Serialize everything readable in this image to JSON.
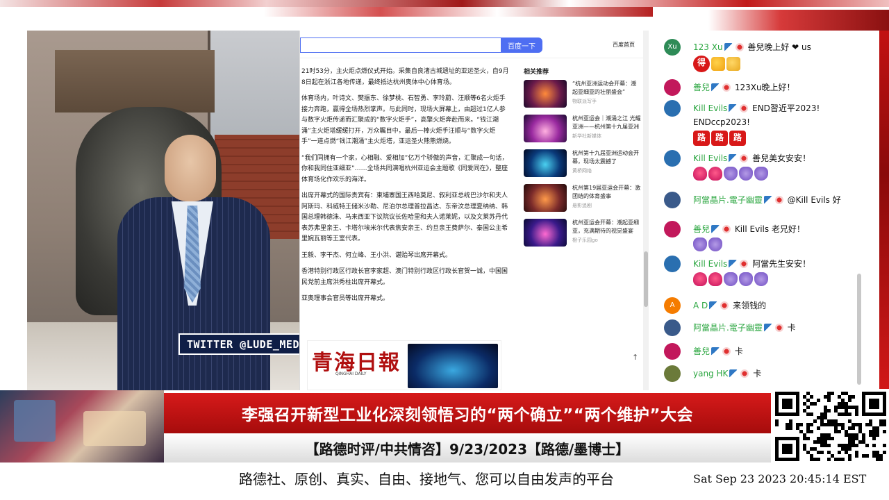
{
  "video": {
    "twitter_label": "TWITTER  @LUDE_MEDIA"
  },
  "browser": {
    "search_button": "百度一下",
    "home_link": "百度首页",
    "article_paragraphs": [
      "21时53分，主火炬点燃仪式开始。采集自良渚古城遗址的亚运圣火，自9月8日起在浙江各地传递，最终抵达杭州奥体中心体育场。",
      "体育场内，叶诗文、樊振东、徐梦桃、石智勇、李玲蔚、汪顺等6名火炬手接力奔跑，赢得全场热烈掌声。与此同时，现场大屏幕上，由超过1亿人参与数字火炬传递而汇聚成的“数字火炬手”，高擎火炬奔赴而来。“钱江潮涌”主火炬塔缓缓打开，万众瞩目中，最后一棒火炬手汪顺与“数字火炬手”一道点燃“钱江潮涌”主火炬塔，亚运圣火熊熊燃烧。",
      "“我们同拥有一个家，心相融、爱相加”亿万个骄傲的声音，汇聚成一句话，你和我同住亚细亚”……全场共同演唱杭州亚运会主题歌《同爱同在》，整座体育场化作欢乐的海洋。",
      "出席开幕式的国际贵宾有：柬埔寨国王西哈莫尼、叙利亚总统巴沙尔和夫人阿斯玛、科威特王储米沙勒、尼泊尔总理普拉昌达、东帝汶总理夏纳纳、韩国总理韩德洙、马来西亚下议院议长佐哈里和夫人诺莱妮，以及文莱苏丹代表苏弗里亲王、卡塔尔埃米尔代表焦安亲王、约旦亲王费萨尔、泰国公主希里婉瓦丽等王室代表。",
      "王毅、李干杰、何立峰、王小洪、谌贻琴出席开幕式。",
      "香港特别行政区行政长官李家超、澳门特别行政区行政长官贺一诚，中国国民党前主席洪秀柱出席开幕式。",
      "亚奥理事会官员等出席开幕式。"
    ],
    "related_title": "相关推荐",
    "related": [
      {
        "title": "“杭州亚洲运动会开幕：潮起亚细亚的壮丽盛会”",
        "source": "物联派写手"
      },
      {
        "title": "杭州亚运会｜潮涌之江 光耀亚洲——杭州第十九届亚洲",
        "source": "新华社新媒体"
      },
      {
        "title": "杭州第十九届亚洲运动会开幕，现场太震撼了",
        "source": "黄桥网络"
      },
      {
        "title": "杭州第19届亚运会开幕：激团结的体育盛事",
        "source": "悬影追剧"
      },
      {
        "title": "杭州亚运会开幕：潮起亚细亚，充满期待的视觉盛宴",
        "source": "橙子乐园go"
      }
    ],
    "newspaper_title": "青海日報",
    "newspaper_sub": "QINGHAI DAILY"
  },
  "chat": {
    "messages": [
      {
        "name": "123 Xu",
        "text": "善兒晚上好 ❤ us",
        "avatar_letter": "Xu",
        "avatar_color": "#2e8b57",
        "emojis": [
          "de",
          "mus",
          "thumb"
        ]
      },
      {
        "name": "善兒",
        "text": "123Xu晚上好！",
        "avatar_letter": "",
        "avatar_color": "#c2185b",
        "emojis": []
      },
      {
        "name": "Kill Evils",
        "text": "END習近平2023! ENDccp2023!",
        "avatar_letter": "",
        "avatar_color": "#2a6fb0",
        "emojis": [
          "lu",
          "lu",
          "lu"
        ]
      },
      {
        "name": "Kill Evils",
        "text": "善兒美女安安！",
        "avatar_letter": "",
        "avatar_color": "#2a6fb0",
        "emojis": [
          "grl",
          "grl",
          "pea",
          "pea",
          "pea"
        ]
      },
      {
        "name": "阿當晶片.電子幽靈",
        "text": "@Kill Evils 好",
        "avatar_letter": "",
        "avatar_color": "#3a5a8a",
        "emojis": []
      },
      {
        "name": "善兒",
        "text": "Kill Evils 老兄好！",
        "avatar_letter": "",
        "avatar_color": "#c2185b",
        "emojis": [
          "pea",
          "pea"
        ]
      },
      {
        "name": "Kill Evils",
        "text": "阿當先生安安！",
        "avatar_letter": "",
        "avatar_color": "#2a6fb0",
        "emojis": [
          "grl",
          "grl",
          "pea",
          "pea",
          "pea"
        ]
      },
      {
        "name": "A D",
        "text": "来领钱的",
        "avatar_letter": "A",
        "avatar_color": "#f57c00",
        "emojis": []
      },
      {
        "name": "阿當晶片.電子幽靈",
        "text": "卡",
        "avatar_letter": "",
        "avatar_color": "#3a5a8a",
        "emojis": []
      },
      {
        "name": "善兒",
        "text": "卡",
        "avatar_letter": "",
        "avatar_color": "#c2185b",
        "emojis": []
      },
      {
        "name": "yang HK",
        "text": "卡",
        "avatar_letter": "",
        "avatar_color": "#6b7a3a",
        "emojis": []
      }
    ],
    "emoji_lu": "路",
    "emoji_de": "得"
  },
  "banner": {
    "headline": "李强召开新型工业化深刻领悟习的“两个确立”“两个维护”大会",
    "subtitle": "【路德时评/中共情咨】9/23/2023【路德/墨博士】",
    "ticker": "路德社、原创、真实、自由、接地气、您可以自由发声的平台",
    "clock": "Sat Sep 23 2023 20:45:14 EST"
  }
}
